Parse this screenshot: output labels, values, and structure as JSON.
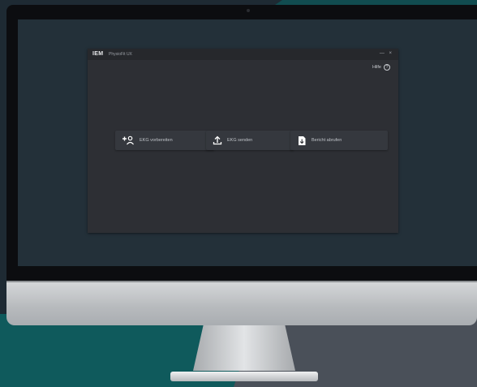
{
  "app": {
    "logo": "IEM",
    "name": "PhysioFit UX",
    "window_controls": "— ×",
    "help_label": "Hilfe",
    "help_icon": "question-circle-icon"
  },
  "actions": [
    {
      "label": "EKG vorbereiten",
      "icon": "add-person-icon"
    },
    {
      "label": "EKG senden",
      "icon": "upload-icon"
    },
    {
      "label": "Bericht abrufen",
      "icon": "document-download-icon"
    }
  ],
  "colors": {
    "background": "#1e2a33",
    "accent_teal": "#0f5a5c",
    "app_window": "#2d2f34",
    "button": "#35383e"
  }
}
